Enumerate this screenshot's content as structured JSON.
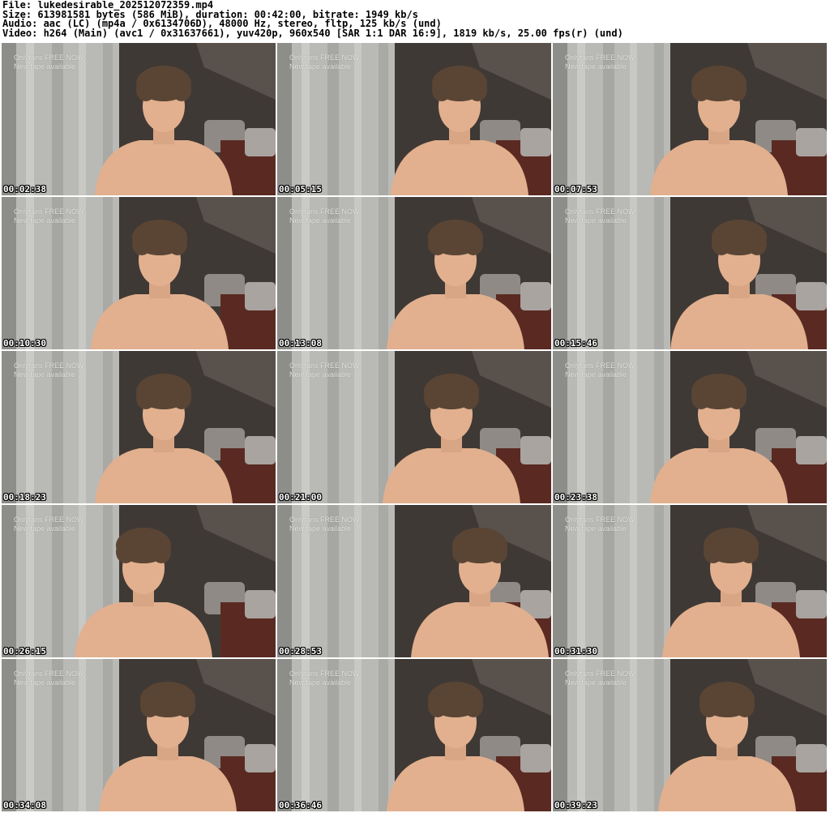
{
  "header": {
    "file": "File: lukedesirable_202512072359.mp4",
    "size": "Size: 613981581 bytes (586 MiB), duration: 00:42:00, bitrate: 1949 kb/s",
    "audio": "Audio: aac (LC) (mp4a / 0x6134706D), 48000 Hz, stereo, fltp, 125 kb/s (und)",
    "video": "Video: h264 (Main) (avc1 / 0x31637661), yuv420p, 960x540 [SAR 1:1 DAR 16:9], 1819 kb/s, 25.00 fps(r) (und)"
  },
  "overlay": {
    "line1": "Onlyfans FREE NOW",
    "line2": "New tape available"
  },
  "colors": {
    "curtain": "#b9b9b6",
    "wall": "#3f3935",
    "skin": "#e2b08e",
    "hair": "#5a4535",
    "bed": "#5a2a22"
  },
  "thumbnails": [
    {
      "time": "00:02:38"
    },
    {
      "time": "00:05:15"
    },
    {
      "time": "00:07:53"
    },
    {
      "time": "00:10:30"
    },
    {
      "time": "00:13:08"
    },
    {
      "time": "00:15:46"
    },
    {
      "time": "00:18:23"
    },
    {
      "time": "00:21:00"
    },
    {
      "time": "00:23:38"
    },
    {
      "time": "00:26:15"
    },
    {
      "time": "00:28:53"
    },
    {
      "time": "00:31:30"
    },
    {
      "time": "00:34:08"
    },
    {
      "time": "00:36:46"
    },
    {
      "time": "00:39:23"
    }
  ]
}
